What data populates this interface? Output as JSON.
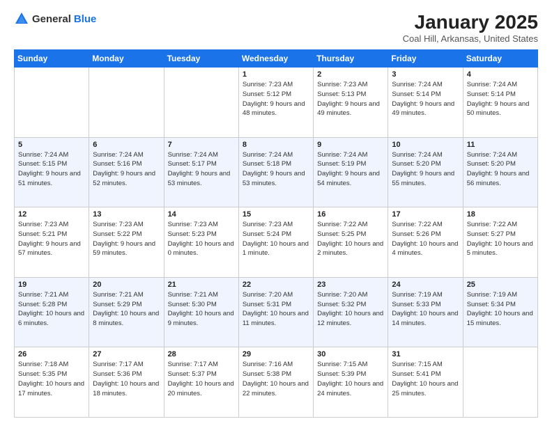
{
  "logo": {
    "text_general": "General",
    "text_blue": "Blue"
  },
  "header": {
    "title": "January 2025",
    "subtitle": "Coal Hill, Arkansas, United States"
  },
  "weekdays": [
    "Sunday",
    "Monday",
    "Tuesday",
    "Wednesday",
    "Thursday",
    "Friday",
    "Saturday"
  ],
  "weeks": [
    [
      {
        "day": "",
        "sunrise": "",
        "sunset": "",
        "daylight": ""
      },
      {
        "day": "",
        "sunrise": "",
        "sunset": "",
        "daylight": ""
      },
      {
        "day": "",
        "sunrise": "",
        "sunset": "",
        "daylight": ""
      },
      {
        "day": "1",
        "sunrise": "Sunrise: 7:23 AM",
        "sunset": "Sunset: 5:12 PM",
        "daylight": "Daylight: 9 hours and 48 minutes."
      },
      {
        "day": "2",
        "sunrise": "Sunrise: 7:23 AM",
        "sunset": "Sunset: 5:13 PM",
        "daylight": "Daylight: 9 hours and 49 minutes."
      },
      {
        "day": "3",
        "sunrise": "Sunrise: 7:24 AM",
        "sunset": "Sunset: 5:14 PM",
        "daylight": "Daylight: 9 hours and 49 minutes."
      },
      {
        "day": "4",
        "sunrise": "Sunrise: 7:24 AM",
        "sunset": "Sunset: 5:14 PM",
        "daylight": "Daylight: 9 hours and 50 minutes."
      }
    ],
    [
      {
        "day": "5",
        "sunrise": "Sunrise: 7:24 AM",
        "sunset": "Sunset: 5:15 PM",
        "daylight": "Daylight: 9 hours and 51 minutes."
      },
      {
        "day": "6",
        "sunrise": "Sunrise: 7:24 AM",
        "sunset": "Sunset: 5:16 PM",
        "daylight": "Daylight: 9 hours and 52 minutes."
      },
      {
        "day": "7",
        "sunrise": "Sunrise: 7:24 AM",
        "sunset": "Sunset: 5:17 PM",
        "daylight": "Daylight: 9 hours and 53 minutes."
      },
      {
        "day": "8",
        "sunrise": "Sunrise: 7:24 AM",
        "sunset": "Sunset: 5:18 PM",
        "daylight": "Daylight: 9 hours and 53 minutes."
      },
      {
        "day": "9",
        "sunrise": "Sunrise: 7:24 AM",
        "sunset": "Sunset: 5:19 PM",
        "daylight": "Daylight: 9 hours and 54 minutes."
      },
      {
        "day": "10",
        "sunrise": "Sunrise: 7:24 AM",
        "sunset": "Sunset: 5:20 PM",
        "daylight": "Daylight: 9 hours and 55 minutes."
      },
      {
        "day": "11",
        "sunrise": "Sunrise: 7:24 AM",
        "sunset": "Sunset: 5:20 PM",
        "daylight": "Daylight: 9 hours and 56 minutes."
      }
    ],
    [
      {
        "day": "12",
        "sunrise": "Sunrise: 7:23 AM",
        "sunset": "Sunset: 5:21 PM",
        "daylight": "Daylight: 9 hours and 57 minutes."
      },
      {
        "day": "13",
        "sunrise": "Sunrise: 7:23 AM",
        "sunset": "Sunset: 5:22 PM",
        "daylight": "Daylight: 9 hours and 59 minutes."
      },
      {
        "day": "14",
        "sunrise": "Sunrise: 7:23 AM",
        "sunset": "Sunset: 5:23 PM",
        "daylight": "Daylight: 10 hours and 0 minutes."
      },
      {
        "day": "15",
        "sunrise": "Sunrise: 7:23 AM",
        "sunset": "Sunset: 5:24 PM",
        "daylight": "Daylight: 10 hours and 1 minute."
      },
      {
        "day": "16",
        "sunrise": "Sunrise: 7:22 AM",
        "sunset": "Sunset: 5:25 PM",
        "daylight": "Daylight: 10 hours and 2 minutes."
      },
      {
        "day": "17",
        "sunrise": "Sunrise: 7:22 AM",
        "sunset": "Sunset: 5:26 PM",
        "daylight": "Daylight: 10 hours and 4 minutes."
      },
      {
        "day": "18",
        "sunrise": "Sunrise: 7:22 AM",
        "sunset": "Sunset: 5:27 PM",
        "daylight": "Daylight: 10 hours and 5 minutes."
      }
    ],
    [
      {
        "day": "19",
        "sunrise": "Sunrise: 7:21 AM",
        "sunset": "Sunset: 5:28 PM",
        "daylight": "Daylight: 10 hours and 6 minutes."
      },
      {
        "day": "20",
        "sunrise": "Sunrise: 7:21 AM",
        "sunset": "Sunset: 5:29 PM",
        "daylight": "Daylight: 10 hours and 8 minutes."
      },
      {
        "day": "21",
        "sunrise": "Sunrise: 7:21 AM",
        "sunset": "Sunset: 5:30 PM",
        "daylight": "Daylight: 10 hours and 9 minutes."
      },
      {
        "day": "22",
        "sunrise": "Sunrise: 7:20 AM",
        "sunset": "Sunset: 5:31 PM",
        "daylight": "Daylight: 10 hours and 11 minutes."
      },
      {
        "day": "23",
        "sunrise": "Sunrise: 7:20 AM",
        "sunset": "Sunset: 5:32 PM",
        "daylight": "Daylight: 10 hours and 12 minutes."
      },
      {
        "day": "24",
        "sunrise": "Sunrise: 7:19 AM",
        "sunset": "Sunset: 5:33 PM",
        "daylight": "Daylight: 10 hours and 14 minutes."
      },
      {
        "day": "25",
        "sunrise": "Sunrise: 7:19 AM",
        "sunset": "Sunset: 5:34 PM",
        "daylight": "Daylight: 10 hours and 15 minutes."
      }
    ],
    [
      {
        "day": "26",
        "sunrise": "Sunrise: 7:18 AM",
        "sunset": "Sunset: 5:35 PM",
        "daylight": "Daylight: 10 hours and 17 minutes."
      },
      {
        "day": "27",
        "sunrise": "Sunrise: 7:17 AM",
        "sunset": "Sunset: 5:36 PM",
        "daylight": "Daylight: 10 hours and 18 minutes."
      },
      {
        "day": "28",
        "sunrise": "Sunrise: 7:17 AM",
        "sunset": "Sunset: 5:37 PM",
        "daylight": "Daylight: 10 hours and 20 minutes."
      },
      {
        "day": "29",
        "sunrise": "Sunrise: 7:16 AM",
        "sunset": "Sunset: 5:38 PM",
        "daylight": "Daylight: 10 hours and 22 minutes."
      },
      {
        "day": "30",
        "sunrise": "Sunrise: 7:15 AM",
        "sunset": "Sunset: 5:39 PM",
        "daylight": "Daylight: 10 hours and 24 minutes."
      },
      {
        "day": "31",
        "sunrise": "Sunrise: 7:15 AM",
        "sunset": "Sunset: 5:41 PM",
        "daylight": "Daylight: 10 hours and 25 minutes."
      },
      {
        "day": "",
        "sunrise": "",
        "sunset": "",
        "daylight": ""
      }
    ]
  ]
}
